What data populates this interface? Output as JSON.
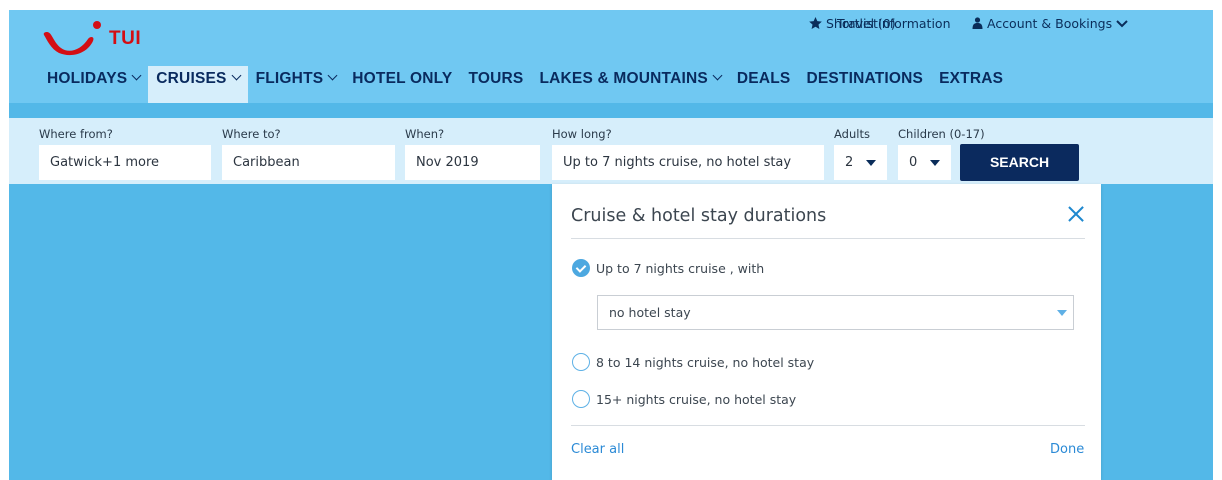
{
  "brand": {
    "name": "TUI",
    "color": "#d40e14",
    "logo_icon": "tui-smile-logo"
  },
  "utility": {
    "shortlist_icon": "star-icon",
    "shortlist": "Shortlist(0)",
    "travel_info": "Travel Information",
    "account_icon": "person-icon",
    "account": "Account & Bookings"
  },
  "nav": {
    "items": [
      {
        "label": "HOLIDAYS",
        "dropdown": true
      },
      {
        "label": "CRUISES",
        "dropdown": true,
        "active": true
      },
      {
        "label": "FLIGHTS",
        "dropdown": true
      },
      {
        "label": "HOTEL ONLY"
      },
      {
        "label": "TOURS"
      },
      {
        "label": "LAKES & MOUNTAINS",
        "dropdown": true
      },
      {
        "label": "DEALS"
      },
      {
        "label": "DESTINATIONS"
      },
      {
        "label": "EXTRAS"
      }
    ]
  },
  "search": {
    "from": {
      "label": "Where from?",
      "value": "Gatwick+1 more"
    },
    "to": {
      "label": "Where to?",
      "value": "Caribbean"
    },
    "when": {
      "label": "When?",
      "value": "Nov 2019"
    },
    "duration": {
      "label": "How long?",
      "value": "Up to 7 nights cruise, no hotel stay"
    },
    "adults": {
      "label": "Adults",
      "value": "2"
    },
    "children": {
      "label": "Children (0-17)",
      "value": "0"
    },
    "button": "SEARCH"
  },
  "popup": {
    "title": "Cruise & hotel stay durations",
    "options": [
      {
        "label": "Up to 7 nights cruise , with",
        "checked": true
      },
      {
        "label": "8 to 14 nights cruise, no hotel stay",
        "checked": false
      },
      {
        "label": "15+ nights cruise, no hotel stay",
        "checked": false
      }
    ],
    "hotel_select": "no hotel stay",
    "clear": "Clear all",
    "done": "Done"
  },
  "colors": {
    "header": "#70c8f2",
    "page": "#53b8e8",
    "searchbar": "#d6eefb",
    "navy": "#0b2a5e",
    "accent": "#2b8ad6"
  }
}
